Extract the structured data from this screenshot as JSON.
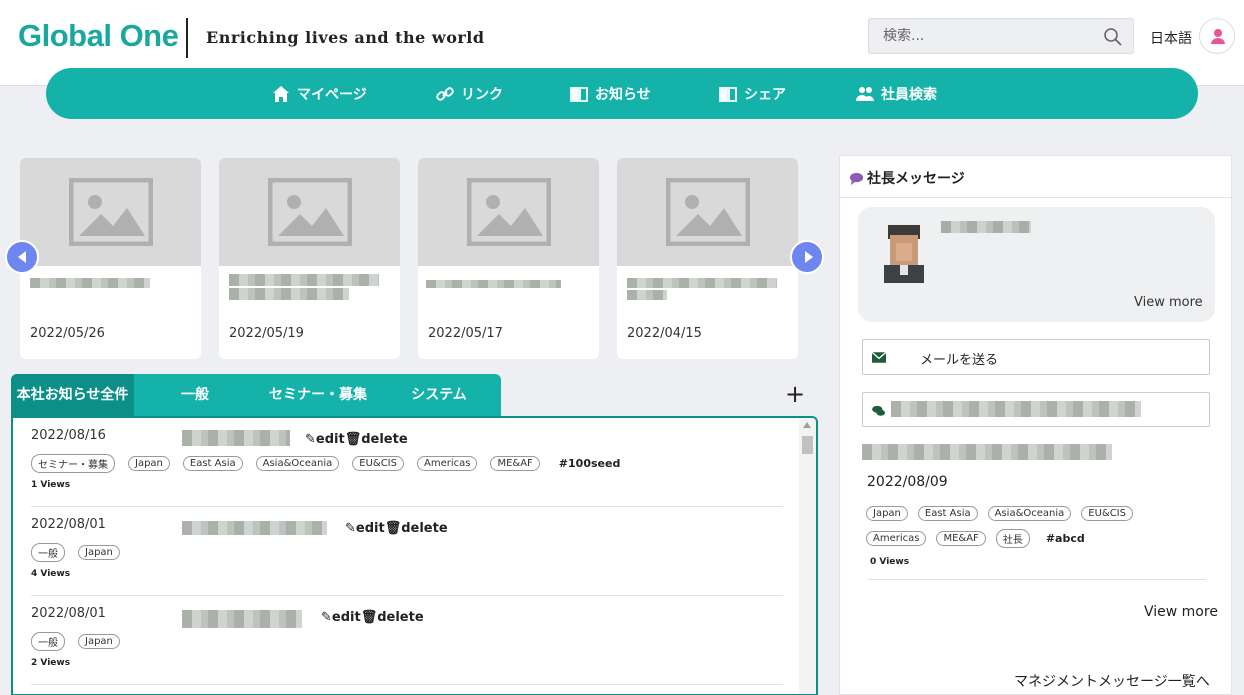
{
  "header": {
    "logo": "Global One",
    "tagline": "Enriching lives and the world",
    "search_placeholder": "検索...",
    "language": "日本語"
  },
  "nav": [
    {
      "label": "マイページ",
      "icon": "home-icon"
    },
    {
      "label": "リンク",
      "icon": "link-icon"
    },
    {
      "label": "お知らせ",
      "icon": "book-icon"
    },
    {
      "label": "シェア",
      "icon": "book-icon"
    },
    {
      "label": "社員検索",
      "icon": "users-icon"
    }
  ],
  "carousel": {
    "cards": [
      {
        "date": "2022/05/26"
      },
      {
        "date": "2022/05/19"
      },
      {
        "date": "2022/05/17"
      },
      {
        "date": "2022/04/15"
      }
    ]
  },
  "tabs": [
    "本社お知らせ全件",
    "一般",
    "セミナー・募集",
    "システム"
  ],
  "add_label": "+",
  "news": {
    "edit_label": "edit",
    "delete_label": "delete",
    "rows": [
      {
        "date": "2022/08/16",
        "tags": [
          "セミナー・募集",
          "Japan",
          "East Asia",
          "Asia&Oceania",
          "EU&CIS",
          "Americas",
          "ME&AF"
        ],
        "hashtag": "#100seed",
        "views": "1 Views"
      },
      {
        "date": "2022/08/01",
        "tags": [
          "一般",
          "Japan"
        ],
        "hashtag": "",
        "views": "4 Views"
      },
      {
        "date": "2022/08/01",
        "tags": [
          "一般",
          "Japan"
        ],
        "hashtag": "",
        "views": "2 Views"
      }
    ]
  },
  "panel": {
    "title": "社長メッセージ",
    "view_more_small": "View more",
    "send_mail": "メールを送る",
    "date": "2022/08/09",
    "tags_row1": [
      "Japan",
      "East Asia",
      "Asia&Oceania",
      "EU&CIS"
    ],
    "tags_row2": [
      "Americas",
      "ME&AF",
      "社長"
    ],
    "hashtag": "#abcd",
    "views": "0 Views",
    "view_more": "View more",
    "management_link": "マネジメントメッセージ一覧へ"
  },
  "colors": {
    "teal": "#14b2a8",
    "teal_dark": "#0b8f86",
    "arrow_blue": "#6e86f0",
    "avatar_pink": "#e8559a"
  }
}
